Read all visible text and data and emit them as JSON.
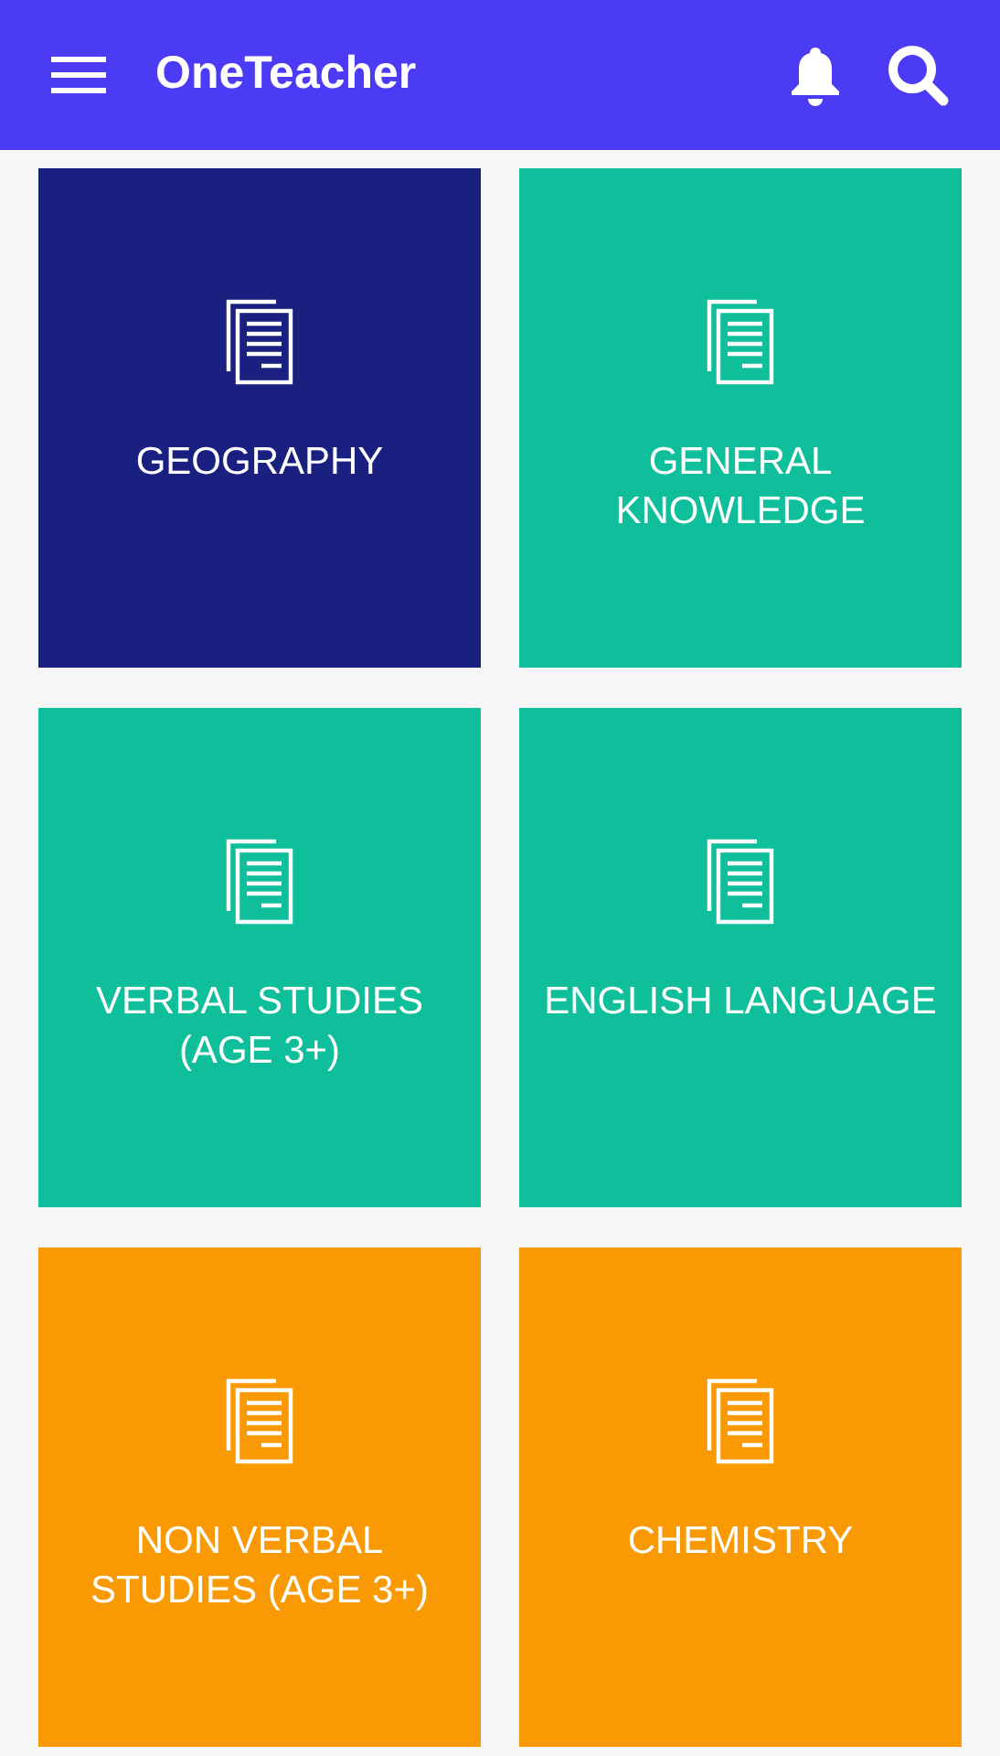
{
  "app_bar": {
    "title": "OneTeacher"
  },
  "tiles": [
    {
      "label": "GEOGRAPHY",
      "color": "#1a2080"
    },
    {
      "label": "GENERAL KNOWLEDGE",
      "color": "#0fbf9b"
    },
    {
      "label": "VERBAL STUDIES (AGE 3+)",
      "color": "#0fbf9b"
    },
    {
      "label": "ENGLISH LANGUAGE",
      "color": "#0fbf9b"
    },
    {
      "label": "NON VERBAL STUDIES (AGE 3+)",
      "color": "#f99a05"
    },
    {
      "label": "CHEMISTRY",
      "color": "#f99a05"
    }
  ]
}
